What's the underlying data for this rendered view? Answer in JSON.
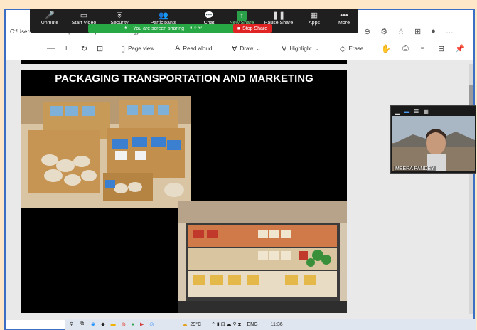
{
  "zoom": {
    "items": [
      {
        "label": "Unmute",
        "icon": "mic-muted-icon"
      },
      {
        "label": "Start Video",
        "icon": "video-off-icon"
      },
      {
        "label": "Security",
        "icon": "shield-icon"
      },
      {
        "label": "Participants",
        "icon": "participants-icon"
      },
      {
        "label": "Chat",
        "icon": "chat-icon"
      },
      {
        "label": "New Share",
        "icon": "share-icon"
      },
      {
        "label": "Pause Share",
        "icon": "pause-icon"
      },
      {
        "label": "Apps",
        "icon": "apps-icon"
      },
      {
        "label": "More",
        "icon": "more-icon"
      }
    ],
    "sharing_text": "You are screen sharing",
    "stop_share": "Stop Share"
  },
  "browser": {
    "path": "C:/Users/admin/Desktop/TOEMP/precious/...nology.pdf"
  },
  "pdf_toolbar": {
    "page_view": "Page view",
    "read_aloud": "Read aloud",
    "draw": "Draw",
    "highlight": "Highlight",
    "erase": "Erase"
  },
  "slide": {
    "title": "PACKAGING TRANSPORTATION AND MARKETING"
  },
  "video": {
    "participant_name": "MEERA PANDEY"
  },
  "taskbar": {
    "weather": "29°C",
    "language": "ENG",
    "time": "11:36"
  }
}
